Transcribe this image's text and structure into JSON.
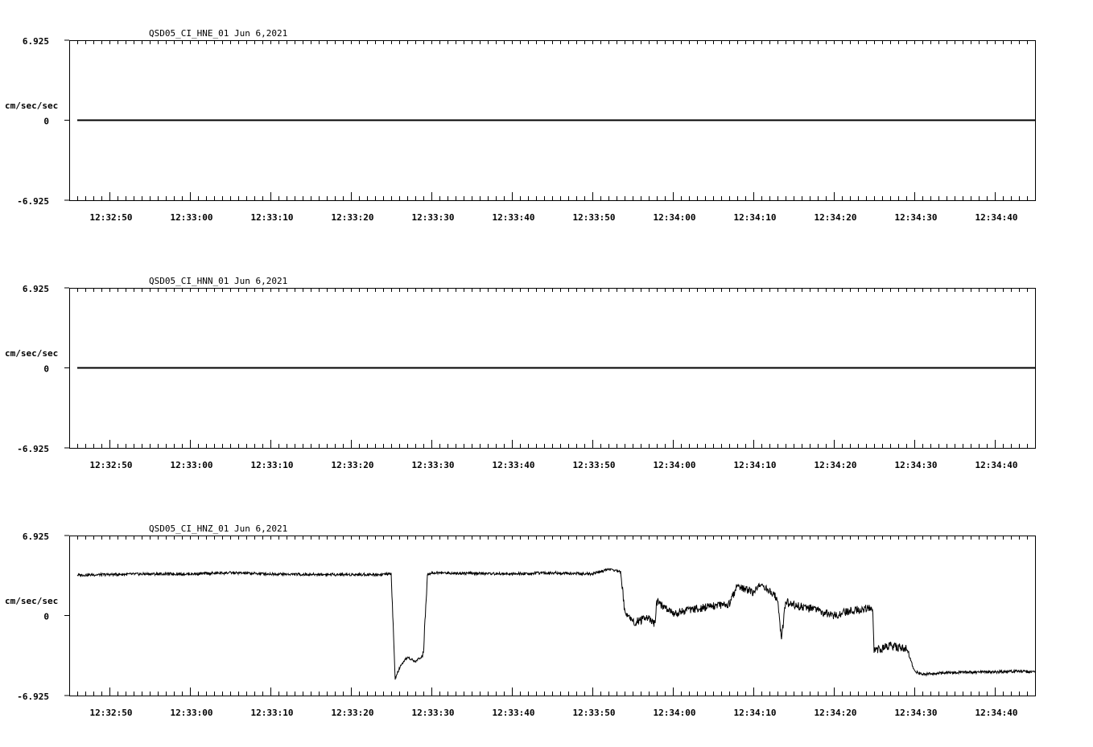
{
  "chart_data": [
    {
      "type": "line",
      "title": "QSD05_CI_HNE_01  Jun 6,2021",
      "ylabel": "cm/sec/sec",
      "ylim": [
        -6.925,
        6.925
      ],
      "ytick_labels": [
        "6.925",
        "0",
        "-6.925"
      ],
      "xlim": [
        "12:32:45",
        "12:34:45"
      ],
      "xtick_labels": [
        "12:32:50",
        "12:33:00",
        "12:33:10",
        "12:33:20",
        "12:33:30",
        "12:33:40",
        "12:33:50",
        "12:34:00",
        "12:34:10",
        "12:34:20",
        "12:34:30",
        "12:34:40"
      ],
      "series": [
        {
          "x": [
            "12:32:46",
            "12:34:45"
          ],
          "values": [
            0,
            0
          ]
        }
      ]
    },
    {
      "type": "line",
      "title": "QSD05_CI_HNN_01  Jun 6,2021",
      "ylabel": "cm/sec/sec",
      "ylim": [
        -6.925,
        6.925
      ],
      "ytick_labels": [
        "6.925",
        "0",
        "-6.925"
      ],
      "xlim": [
        "12:32:45",
        "12:34:45"
      ],
      "xtick_labels": [
        "12:32:50",
        "12:33:00",
        "12:33:10",
        "12:33:20",
        "12:33:30",
        "12:33:40",
        "12:33:50",
        "12:34:00",
        "12:34:10",
        "12:34:20",
        "12:34:30",
        "12:34:40"
      ],
      "series": [
        {
          "x": [
            "12:32:46",
            "12:34:45"
          ],
          "values": [
            0,
            0
          ]
        }
      ]
    },
    {
      "type": "line",
      "title": "QSD05_CI_HNZ_01  Jun 6,2021",
      "ylabel": "cm/sec/sec",
      "ylim": [
        -6.925,
        6.925
      ],
      "ytick_labels": [
        "6.925",
        "0",
        "-6.925"
      ],
      "xlim": [
        "12:32:45",
        "12:34:45"
      ],
      "xtick_labels": [
        "12:32:50",
        "12:33:00",
        "12:33:10",
        "12:33:20",
        "12:33:30",
        "12:33:40",
        "12:33:50",
        "12:34:00",
        "12:34:10",
        "12:34:20",
        "12:34:30",
        "12:34:40"
      ],
      "series": [
        {
          "x": [
            "12:32:46",
            "12:32:50",
            "12:32:55",
            "12:33:00",
            "12:33:05",
            "12:33:10",
            "12:33:15",
            "12:33:20",
            "12:33:24",
            "12:33:25",
            "12:33:25.5",
            "12:33:26",
            "12:33:27",
            "12:33:28",
            "12:33:29",
            "12:33:29.5",
            "12:33:30",
            "12:33:35",
            "12:33:40",
            "12:33:45",
            "12:33:50",
            "12:33:52",
            "12:33:53",
            "12:33:53.5",
            "12:33:54",
            "12:33:55",
            "12:33:57",
            "12:33:57.8",
            "12:33:58",
            "12:34:00",
            "12:34:03",
            "12:34:06",
            "12:34:07",
            "12:34:08",
            "12:34:10",
            "12:34:11",
            "12:34:13",
            "12:34:13.5",
            "12:34:14",
            "12:34:15",
            "12:34:17",
            "12:34:20",
            "12:34:22",
            "12:34:24",
            "12:34:24.8",
            "12:34:25",
            "12:34:27",
            "12:34:29",
            "12:34:29.5",
            "12:34:30",
            "12:34:31",
            "12:34:33",
            "12:34:36",
            "12:34:40",
            "12:34:43",
            "12:34:45"
          ],
          "values": [
            3.5,
            3.55,
            3.6,
            3.6,
            3.7,
            3.6,
            3.55,
            3.55,
            3.55,
            3.6,
            -5.5,
            -4.6,
            -3.6,
            -4.0,
            -3.4,
            3.6,
            3.7,
            3.65,
            3.6,
            3.7,
            3.6,
            4.0,
            3.9,
            3.8,
            0.5,
            -0.6,
            -0.2,
            -0.8,
            1.2,
            0.2,
            0.6,
            0.9,
            1.0,
            2.6,
            2.0,
            2.7,
            1.5,
            -2.1,
            1.2,
            0.9,
            0.6,
            0.0,
            0.4,
            0.6,
            0.8,
            -3.0,
            -2.6,
            -2.9,
            -3.8,
            -4.8,
            -5.1,
            -5.0,
            -4.9,
            -4.9,
            -4.8,
            -4.9
          ]
        }
      ]
    }
  ]
}
